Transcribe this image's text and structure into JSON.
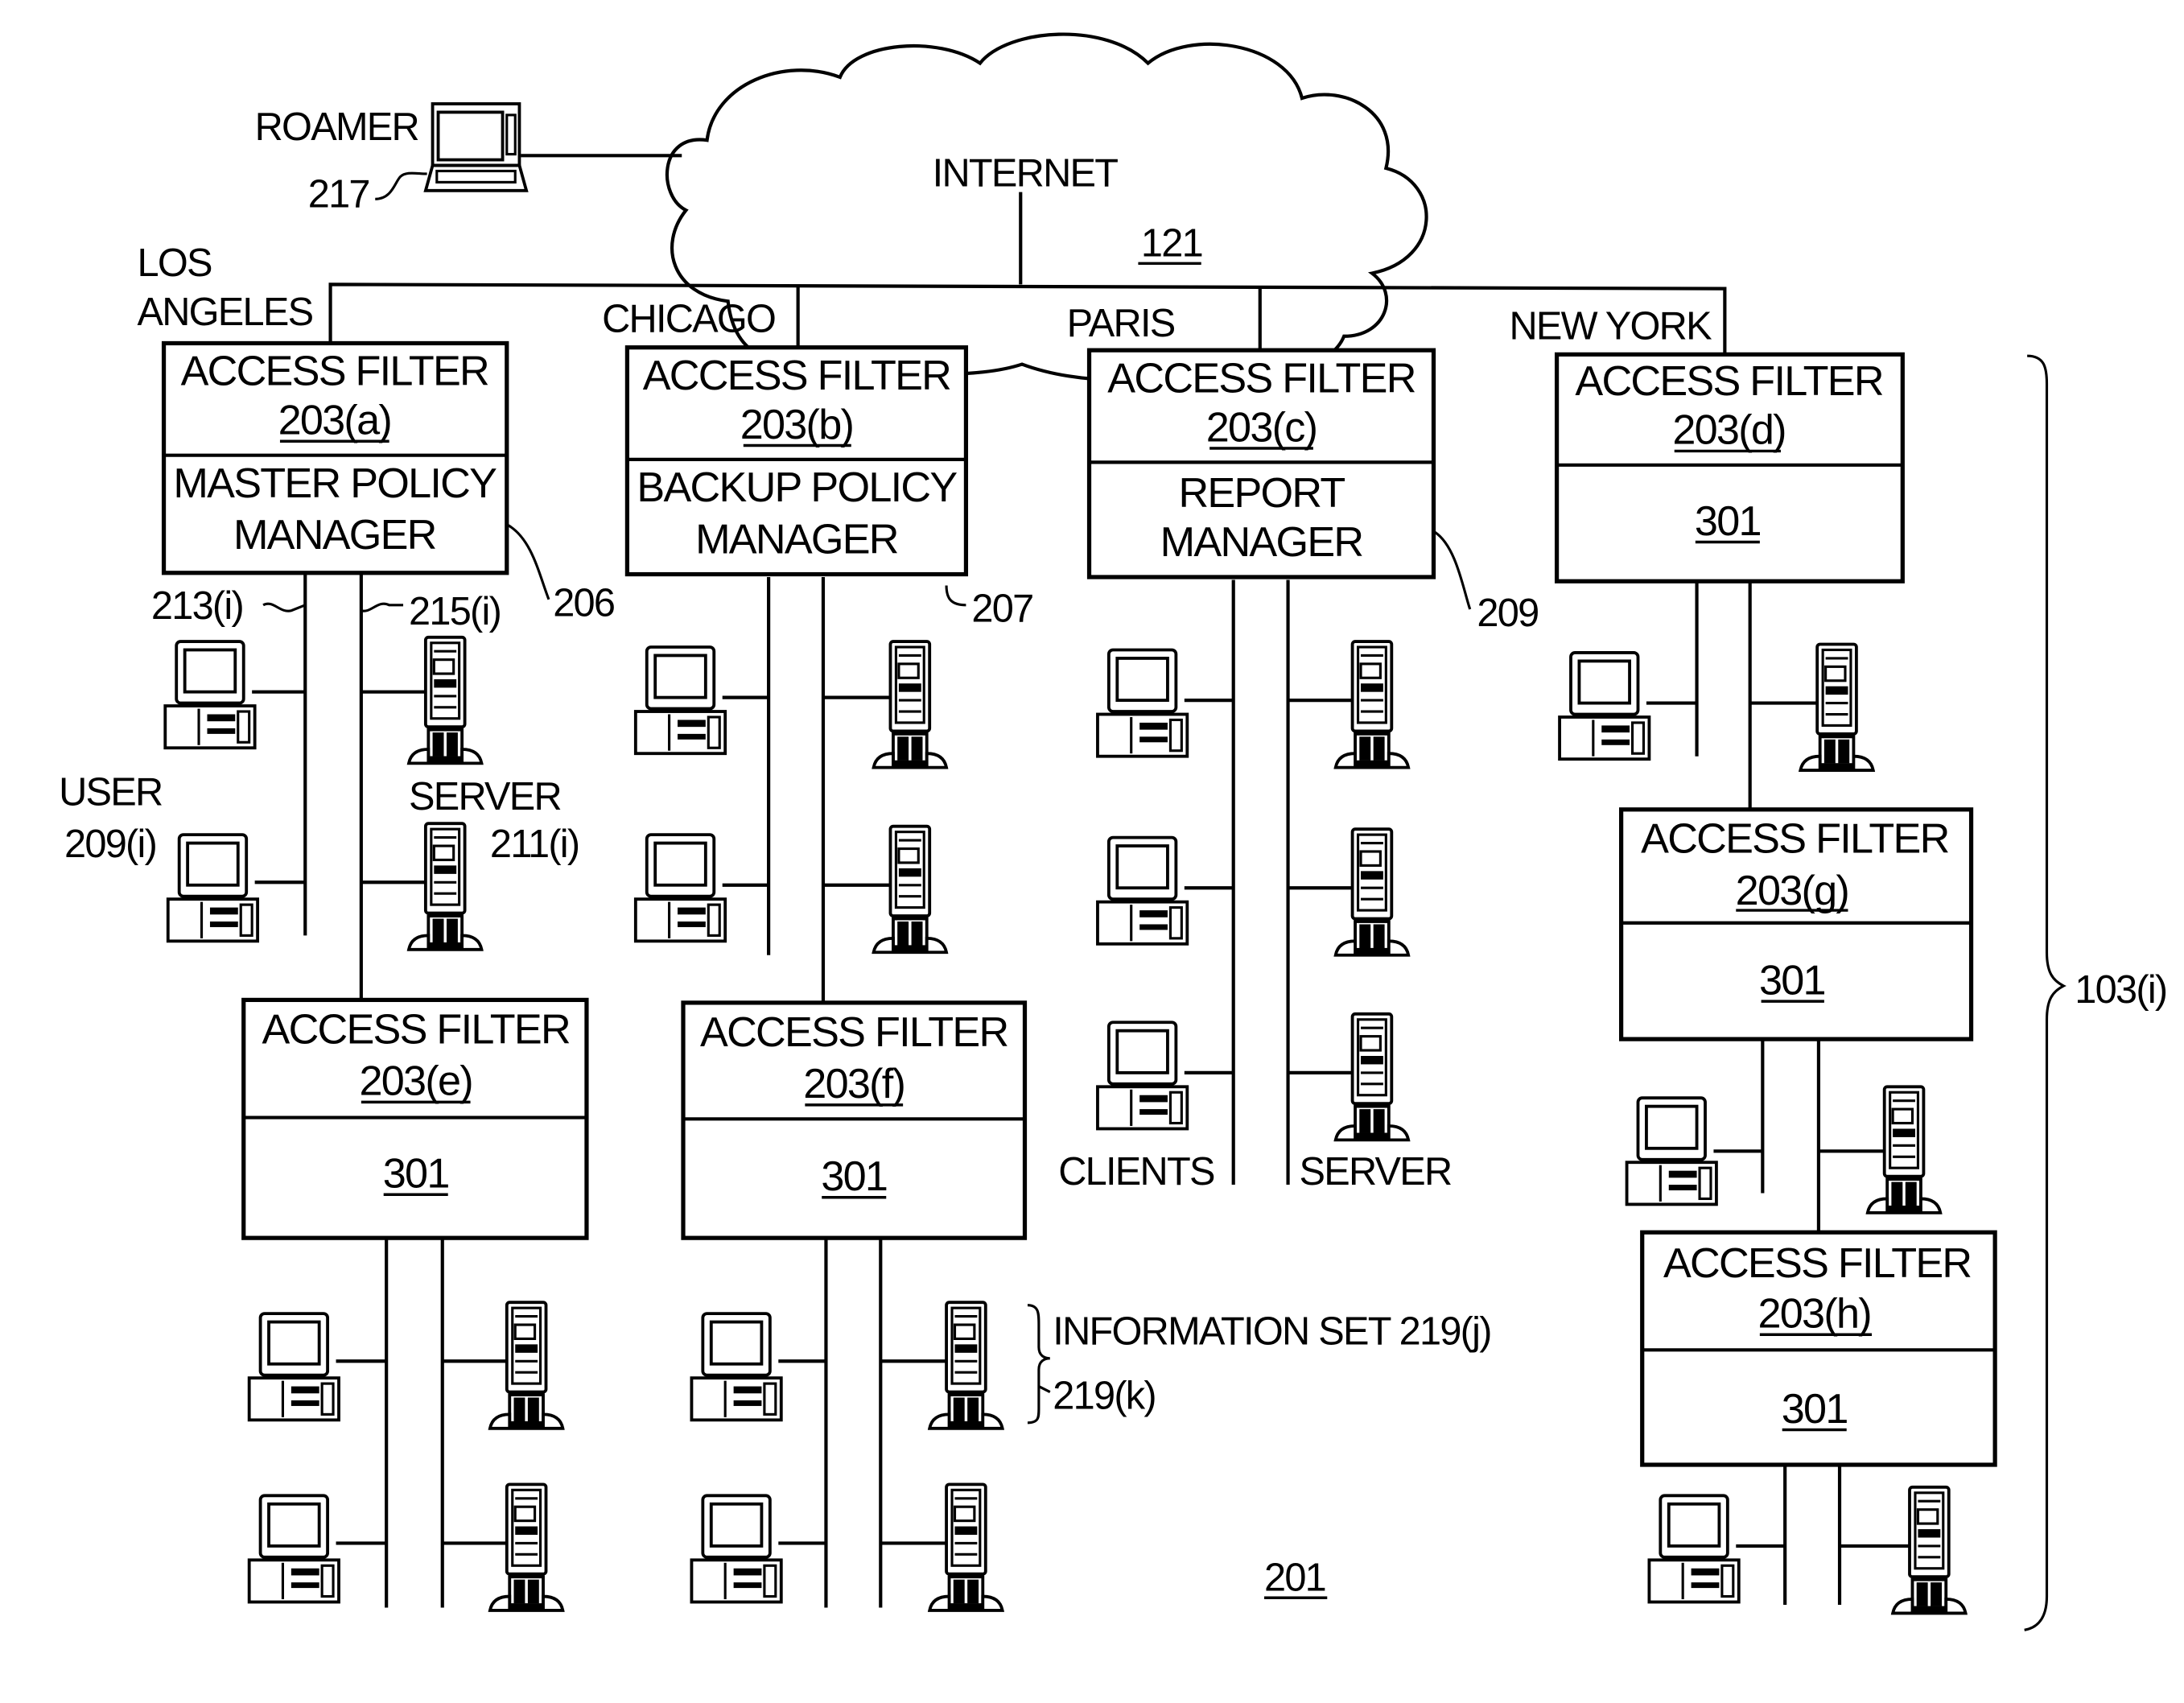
{
  "diagram": {
    "figure_number": "201",
    "internet": {
      "label": "INTERNET",
      "ref": "121"
    },
    "roamer": {
      "label": "ROAMER",
      "ref": "217"
    },
    "sites": [
      {
        "name": "LOS ANGELES",
        "name_lines": [
          "LOS",
          "ANGELES"
        ]
      },
      {
        "name": "CHICAGO"
      },
      {
        "name": "PARIS"
      },
      {
        "name": "NEW YORK"
      }
    ],
    "filters": [
      {
        "id": "a",
        "title": "ACCESS FILTER",
        "ref": "203(a)",
        "lower_lines": [
          "MASTER POLICY",
          "MANAGER"
        ],
        "callout": "206"
      },
      {
        "id": "b",
        "title": "ACCESS FILTER",
        "ref": "203(b)",
        "lower_lines": [
          "BACKUP POLICY",
          "MANAGER"
        ],
        "callout": "207"
      },
      {
        "id": "c",
        "title": "ACCESS FILTER",
        "ref": "203(c)",
        "lower_lines": [
          "REPORT",
          "MANAGER"
        ],
        "callout": "209"
      },
      {
        "id": "d",
        "title": "ACCESS FILTER",
        "ref": "203(d)",
        "lower_lines": [
          "301"
        ]
      },
      {
        "id": "e",
        "title": "ACCESS FILTER",
        "ref": "203(e)",
        "lower_lines": [
          "301"
        ]
      },
      {
        "id": "f",
        "title": "ACCESS FILTER",
        "ref": "203(f)",
        "lower_lines": [
          "301"
        ]
      },
      {
        "id": "g",
        "title": "ACCESS FILTER",
        "ref": "203(g)",
        "lower_lines": [
          "301"
        ]
      },
      {
        "id": "h",
        "title": "ACCESS FILTER",
        "ref": "203(h)",
        "lower_lines": [
          "301"
        ]
      }
    ],
    "labels": {
      "network_a": "213(i)",
      "network_b": "215(i)",
      "user_line1": "USER",
      "user_line2": "209(i)",
      "server_line1": "SERVER",
      "server_line2": "211(i)",
      "clients": "CLIENTS",
      "server_paris": "SERVER",
      "info_set": "INFORMATION SET 219(j)",
      "info_set_k": "219(k)",
      "bracket_group": "103(i)"
    }
  }
}
